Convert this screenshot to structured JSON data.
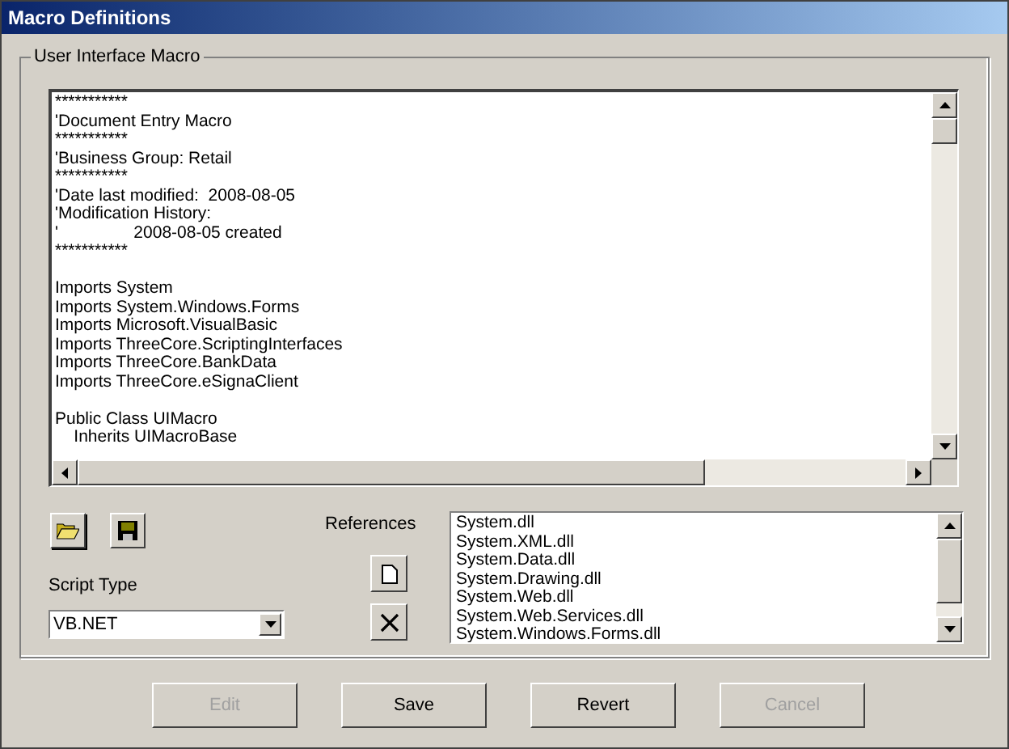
{
  "window": {
    "title": "Macro Definitions"
  },
  "group": {
    "title": "User Interface Macro"
  },
  "code_blocks": [
    [
      "***********",
      "'Document Entry Macro",
      "***********",
      "'Business Group: Retail",
      "***********",
      "'Date last modified:  2008-08-05",
      "'Modification History:",
      "'                2008-08-05 created",
      "***********"
    ],
    [
      "Imports System",
      "Imports System.Windows.Forms",
      "Imports Microsoft.VisualBasic",
      "Imports ThreeCore.ScriptingInterfaces",
      "Imports ThreeCore.BankData",
      "Imports ThreeCore.eSignaClient"
    ],
    [
      "Public Class UIMacro",
      "    Inherits UIMacroBase"
    ]
  ],
  "script_type": {
    "label": "Script Type",
    "value": "VB.NET"
  },
  "references": {
    "label": "References",
    "items": [
      "System.dll",
      "System.XML.dll",
      "System.Data.dll",
      "System.Drawing.dll",
      "System.Web.dll",
      "System.Web.Services.dll",
      "System.Windows.Forms.dll"
    ]
  },
  "buttons": [
    {
      "label": "Edit",
      "disabled": true
    },
    {
      "label": "Save",
      "disabled": false
    },
    {
      "label": "Revert",
      "disabled": false
    },
    {
      "label": "Cancel",
      "disabled": true
    }
  ]
}
